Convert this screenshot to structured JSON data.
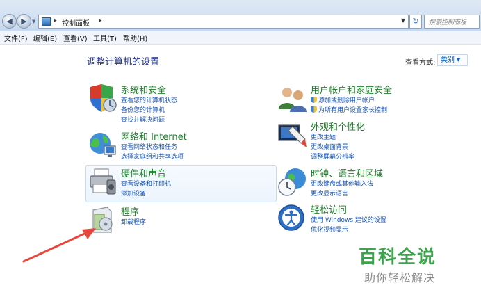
{
  "address_bar": {
    "breadcrumb": "控制面板",
    "search_placeholder": "搜索控制面板"
  },
  "menu": [
    {
      "label": "文件(F)"
    },
    {
      "label": "编辑(E)"
    },
    {
      "label": "查看(V)"
    },
    {
      "label": "工具(T)"
    },
    {
      "label": "帮助(H)"
    }
  ],
  "main": {
    "title": "调整计算机的设置",
    "view_by_label": "查看方式:",
    "view_by_value": "类别 ▾"
  },
  "categories": [
    {
      "title": "系统和安全",
      "links": [
        "查看您的计算机状态",
        "备份您的计算机",
        "查找并解决问题"
      ],
      "icon": "security-shield-icon"
    },
    {
      "title": "网络和 Internet",
      "links": [
        "查看网络状态和任务",
        "选择家庭组和共享选项"
      ],
      "icon": "network-globe-icon"
    },
    {
      "title": "硬件和声音",
      "links": [
        "查看设备和打印机",
        "添加设备"
      ],
      "icon": "printer-icon"
    },
    {
      "title": "程序",
      "links": [
        "卸载程序"
      ],
      "icon": "programs-icon"
    },
    {
      "title": "用户帐户和家庭安全",
      "links": [
        "添加或删除用户帐户",
        "为所有用户设置家长控制"
      ],
      "icon": "users-icon"
    },
    {
      "title": "外观和个性化",
      "links": [
        "更改主题",
        "更改桌面背景",
        "调整屏幕分辨率"
      ],
      "icon": "appearance-icon"
    },
    {
      "title": "时钟、语言和区域",
      "links": [
        "更改键盘或其他输入法",
        "更改显示语言"
      ],
      "icon": "clock-globe-icon"
    },
    {
      "title": "轻松访问",
      "links": [
        "使用 Windows 建议的设置",
        "优化视频显示"
      ],
      "icon": "ease-of-access-icon"
    }
  ],
  "watermark": {
    "title": "百科全说",
    "subtitle": "助你轻松解决"
  },
  "colors": {
    "category_title": "#1e7f2a",
    "link": "#1a57b8",
    "page_title": "#1e3287",
    "arrow": "#e8453c",
    "watermark_green": "#3aa54a"
  }
}
